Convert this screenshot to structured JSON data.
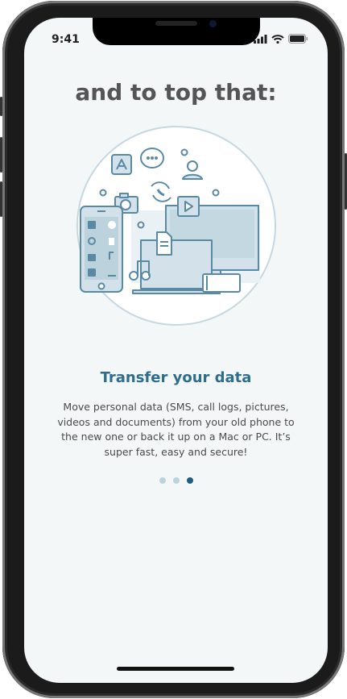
{
  "status_bar": {
    "time": "9:41",
    "icons": [
      "signal-icon",
      "wifi-icon",
      "battery-icon"
    ]
  },
  "headline": "and to top that:",
  "illustration": {
    "icons": [
      "app-logo-icon",
      "chat-bubble-icon",
      "contact-icon",
      "call-sync-icon",
      "camera-icon",
      "play-icon",
      "document-icon",
      "music-note-icon",
      "phone-icon",
      "monitor-icon",
      "laptop-icon",
      "tablet-icon"
    ]
  },
  "feature": {
    "title": "Transfer your data",
    "description": "Move personal data (SMS, call logs, pictures, videos and documents) from your old phone to the new one or back it up on a Mac or PC. It’s super fast, easy and secure!"
  },
  "pagination": {
    "count": 3,
    "active_index": 2
  },
  "colors": {
    "accent": "#2d6e8e",
    "illustration_stroke": "#5a8aa3",
    "illustration_fill": "#d3e2ea",
    "dot_active": "#1f5e7e",
    "dot_inactive": "#bcd2dd",
    "background": "#f4f7f8"
  }
}
